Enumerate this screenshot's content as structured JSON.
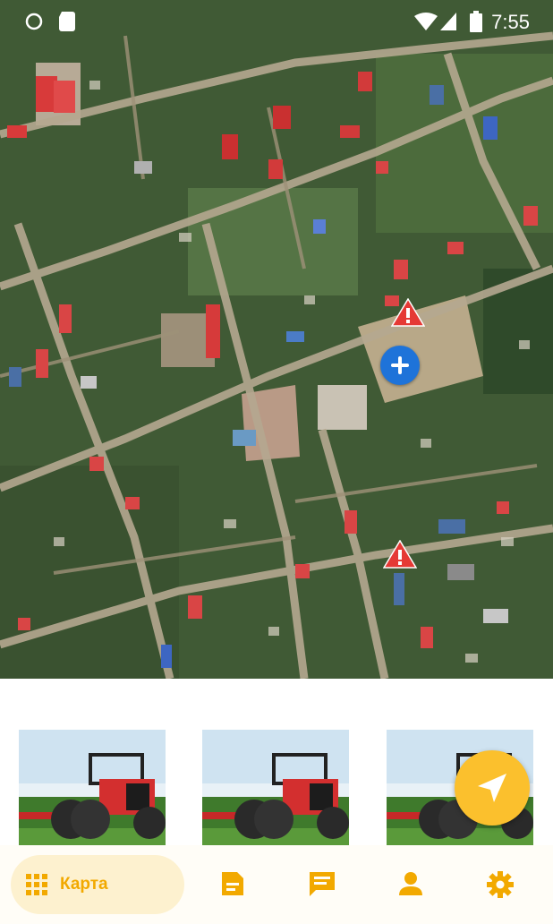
{
  "status_bar": {
    "time": "7:55"
  },
  "map": {
    "markers": [
      "warning-marker",
      "warning-marker",
      "add-marker"
    ]
  },
  "cards": [
    {
      "image": "tractor-photo"
    },
    {
      "image": "tractor-photo"
    },
    {
      "image": "tractor-photo"
    }
  ],
  "fab": {
    "icon": "navigation-arrow-icon"
  },
  "bottom_nav": {
    "active_label": "Карта",
    "items": [
      {
        "icon": "grid-icon",
        "label": "Карта",
        "active": true
      },
      {
        "icon": "document-icon"
      },
      {
        "icon": "chat-icon"
      },
      {
        "icon": "person-icon"
      },
      {
        "icon": "gear-icon"
      }
    ]
  },
  "colors": {
    "accent": "#fbc02d",
    "accent_text": "#f2a900",
    "pill_bg": "#fdf1cf",
    "marker_blue": "#1e73d9",
    "warning_red": "#e53935"
  }
}
